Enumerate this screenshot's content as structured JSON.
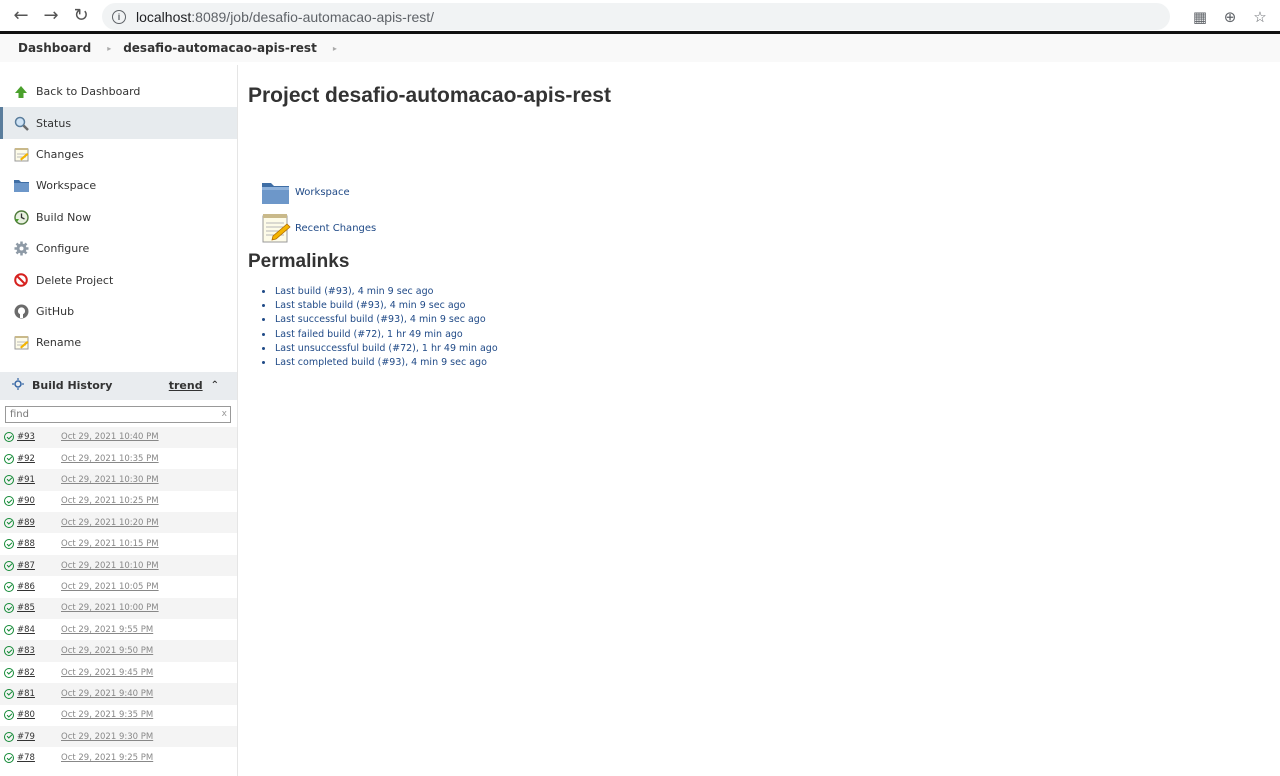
{
  "browser": {
    "url_host": "localhost",
    "url_rest": ":8089/job/desafio-automacao-apis-rest/",
    "icons": [
      "back-icon",
      "forward-icon",
      "reload-icon",
      "translate-icon",
      "zoom-icon",
      "bookmark-star-icon"
    ]
  },
  "breadcrumb": {
    "home": "Dashboard",
    "job": "desafio-automacao-apis-rest"
  },
  "sidebar": {
    "tasks": [
      {
        "label": "Back to Dashboard",
        "icon": "up-arrow-icon"
      },
      {
        "label": "Status",
        "icon": "magnifier-icon"
      },
      {
        "label": "Changes",
        "icon": "notepad-icon"
      },
      {
        "label": "Workspace",
        "icon": "folder-icon"
      },
      {
        "label": "Build Now",
        "icon": "clock-icon"
      },
      {
        "label": "Configure",
        "icon": "gear-icon"
      },
      {
        "label": "Delete Project",
        "icon": "no-entry-icon"
      },
      {
        "label": "GitHub",
        "icon": "github-icon"
      },
      {
        "label": "Rename",
        "icon": "notepad-icon"
      }
    ],
    "active": "Status"
  },
  "build_history": {
    "title": "Build History",
    "trend": "trend",
    "search_placeholder": "find",
    "clear": "x",
    "builds": [
      {
        "num": "#93",
        "date": "Oct 29, 2021 10:40 PM"
      },
      {
        "num": "#92",
        "date": "Oct 29, 2021 10:35 PM"
      },
      {
        "num": "#91",
        "date": "Oct 29, 2021 10:30 PM"
      },
      {
        "num": "#90",
        "date": "Oct 29, 2021 10:25 PM"
      },
      {
        "num": "#89",
        "date": "Oct 29, 2021 10:20 PM"
      },
      {
        "num": "#88",
        "date": "Oct 29, 2021 10:15 PM"
      },
      {
        "num": "#87",
        "date": "Oct 29, 2021 10:10 PM"
      },
      {
        "num": "#86",
        "date": "Oct 29, 2021 10:05 PM"
      },
      {
        "num": "#85",
        "date": "Oct 29, 2021 10:00 PM"
      },
      {
        "num": "#84",
        "date": "Oct 29, 2021 9:55 PM"
      },
      {
        "num": "#83",
        "date": "Oct 29, 2021 9:50 PM"
      },
      {
        "num": "#82",
        "date": "Oct 29, 2021 9:45 PM"
      },
      {
        "num": "#81",
        "date": "Oct 29, 2021 9:40 PM"
      },
      {
        "num": "#80",
        "date": "Oct 29, 2021 9:35 PM"
      },
      {
        "num": "#79",
        "date": "Oct 29, 2021 9:30 PM"
      },
      {
        "num": "#78",
        "date": "Oct 29, 2021 9:25 PM"
      }
    ]
  },
  "main": {
    "title": "Project desafio-automacao-apis-rest",
    "workspace_link": "Workspace",
    "recent_changes_link": "Recent Changes",
    "permalinks_title": "Permalinks",
    "permalinks": [
      "Last build (#93), 4 min 9 sec ago",
      "Last stable build (#93), 4 min 9 sec ago",
      "Last successful build (#93), 4 min 9 sec ago",
      "Last failed build (#72), 1 hr 49 min ago",
      "Last unsuccessful build (#72), 1 hr 49 min ago",
      "Last completed build (#93), 4 min 9 sec ago"
    ]
  }
}
